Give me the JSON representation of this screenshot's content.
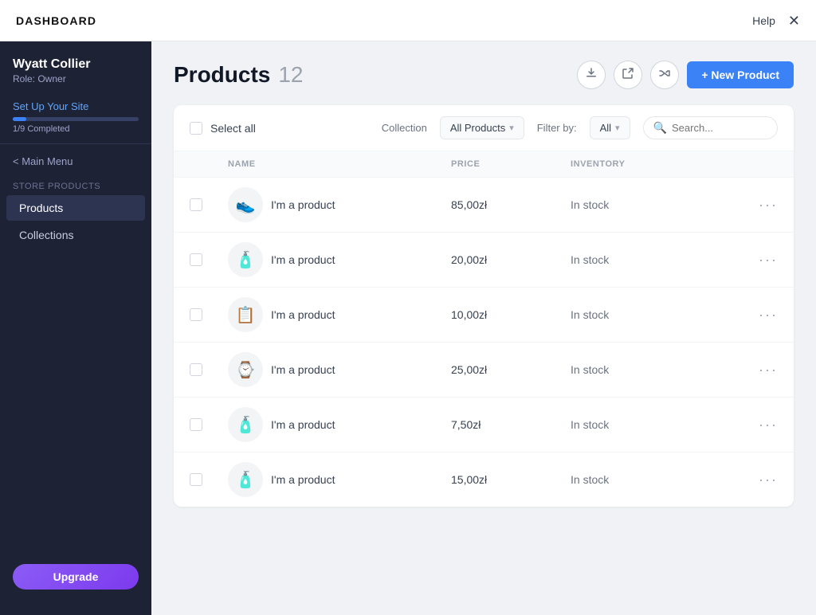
{
  "topbar": {
    "title": "DASHBOARD",
    "help": "Help",
    "close": "✕"
  },
  "sidebar": {
    "username": "Wyatt Collier",
    "role": "Role: Owner",
    "setup_label": "Set Up Your Site",
    "progress_value": 11,
    "progress_text": "1/9 Completed",
    "main_menu": "< Main Menu",
    "section_label": "Store Products",
    "items": [
      {
        "label": "Products",
        "active": true
      },
      {
        "label": "Collections",
        "active": false
      }
    ],
    "upgrade_btn": "Upgrade"
  },
  "header": {
    "title": "Products",
    "count": "12",
    "icons": [
      "⬇",
      "↗",
      "⇄"
    ],
    "new_product_btn": "+ New Product"
  },
  "filter_bar": {
    "select_all": "Select all",
    "collection_label": "Collection",
    "collection_value": "All Products",
    "filter_label": "Filter by:",
    "filter_value": "All",
    "search_placeholder": "Search..."
  },
  "table": {
    "columns": [
      "",
      "NAME",
      "PRICE",
      "INVENTORY",
      ""
    ],
    "rows": [
      {
        "icon": "👟",
        "name": "I'm a product",
        "price": "85,00zł",
        "inventory": "In stock"
      },
      {
        "icon": "🧴",
        "name": "I'm a product",
        "price": "20,00zł",
        "inventory": "In stock"
      },
      {
        "icon": "📋",
        "name": "I'm a product",
        "price": "10,00zł",
        "inventory": "In stock"
      },
      {
        "icon": "⌚",
        "name": "I'm a product",
        "price": "25,00zł",
        "inventory": "In stock"
      },
      {
        "icon": "🧴",
        "name": "I'm a product",
        "price": "7,50zł",
        "inventory": "In stock"
      },
      {
        "icon": "🧴",
        "name": "I'm a product",
        "price": "15,00zł",
        "inventory": "In stock"
      }
    ]
  },
  "icons": {
    "download": "⬇",
    "export": "↗",
    "shuffle": "⇄",
    "search": "🔍",
    "chevron_down": "▾"
  }
}
